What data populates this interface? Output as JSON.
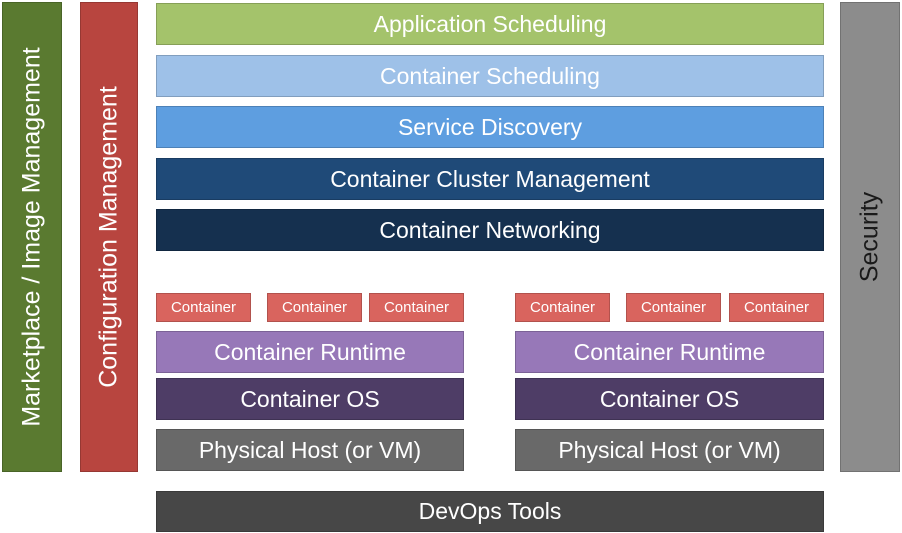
{
  "side_bars": {
    "marketplace": {
      "label": "Marketplace / Image Management",
      "color": "#5a7a30"
    },
    "configuration": {
      "label": "Configuration Management",
      "color": "#b8453f"
    },
    "security": {
      "label": "Security",
      "color": "#8c8c8c"
    }
  },
  "top_layers": [
    {
      "label": "Application Scheduling",
      "color": "#a4c36b"
    },
    {
      "label": "Container Scheduling",
      "color": "#9ec1e8"
    },
    {
      "label": "Service Discovery",
      "color": "#5e9ee0"
    },
    {
      "label": "Container Cluster Management",
      "color": "#1f4a78"
    },
    {
      "label": "Container Networking",
      "color": "#15304f"
    }
  ],
  "hosts": [
    {
      "containers": [
        "Container",
        "Container",
        "Container"
      ],
      "runtime": "Container Runtime",
      "os": "Container OS",
      "host": "Physical Host (or VM)"
    },
    {
      "containers": [
        "Container",
        "Container",
        "Container"
      ],
      "runtime": "Container Runtime",
      "os": "Container OS",
      "host": "Physical Host (or VM)"
    }
  ],
  "colors": {
    "container": "#d9645e",
    "runtime": "#9778b8",
    "os": "#4e3d66",
    "host": "#696969",
    "devops": "#474747"
  },
  "devops": {
    "label": "DevOps Tools"
  }
}
